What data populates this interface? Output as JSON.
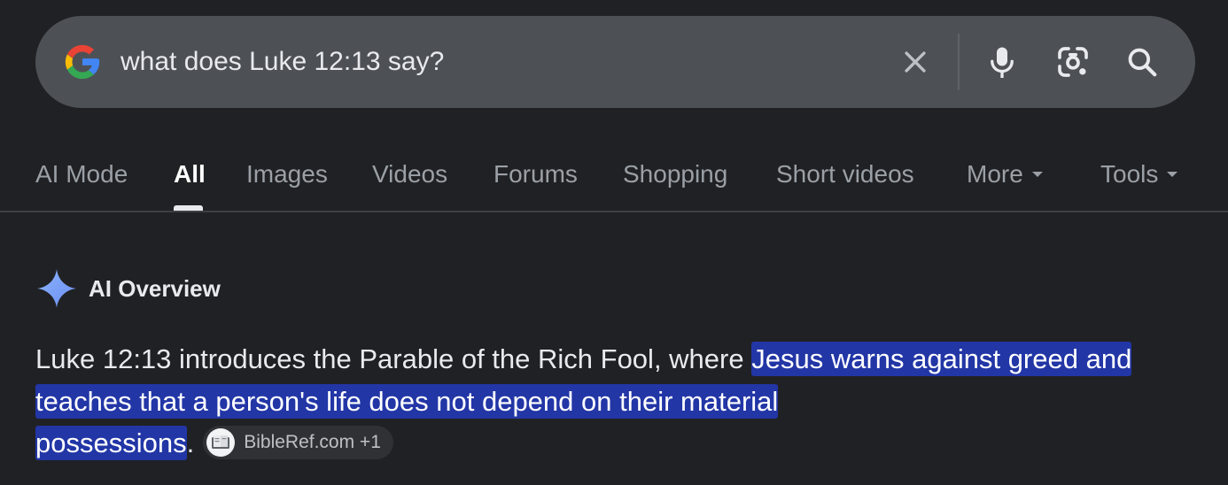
{
  "search": {
    "query": "what does Luke 12:13 say?"
  },
  "tabs": [
    {
      "label": "AI Mode"
    },
    {
      "label": "All"
    },
    {
      "label": "Images"
    },
    {
      "label": "Videos"
    },
    {
      "label": "Forums"
    },
    {
      "label": "Shopping"
    },
    {
      "label": "Short videos"
    },
    {
      "label": "More"
    },
    {
      "label": "Tools"
    }
  ],
  "ai_overview": {
    "title": "AI Overview",
    "text_plain": "Luke 12:13 introduces the Parable of the Rich Fool, where ",
    "text_line1_highlight": "Jesus warns against greed and",
    "text_line2_highlight": "teaches that a person's life does not depend on their material",
    "text_line3_highlight": "possessions",
    "text_period": ".",
    "source_chip": "BibleRef.com +1"
  },
  "colors": {
    "background": "#202124",
    "searchbar": "#4d5156",
    "highlight": "#2236a6",
    "chip": "#303134"
  },
  "icons": [
    "google-logo-icon",
    "clear-icon",
    "mic-icon",
    "lens-icon",
    "search-icon",
    "sparkle-icon",
    "bibleref-favicon-icon"
  ]
}
